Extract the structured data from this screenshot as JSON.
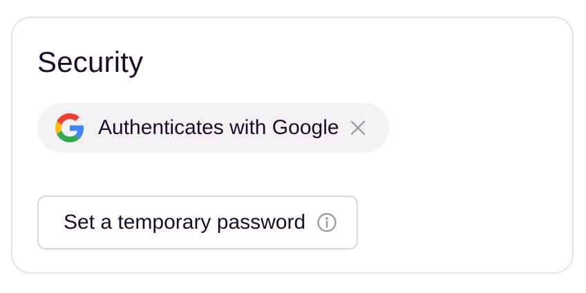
{
  "security": {
    "title": "Security",
    "auth_chip": {
      "label": "Authenticates with Google",
      "provider_icon": "google-g-icon",
      "remove_icon": "close-icon"
    },
    "temp_password_button": {
      "label": "Set a temporary password",
      "info_icon": "info-icon"
    }
  },
  "colors": {
    "text": "#1e0a2a",
    "chip_bg": "#f3f1f4",
    "border": "#e4e3e6",
    "icon_muted": "#9e9aa2"
  }
}
